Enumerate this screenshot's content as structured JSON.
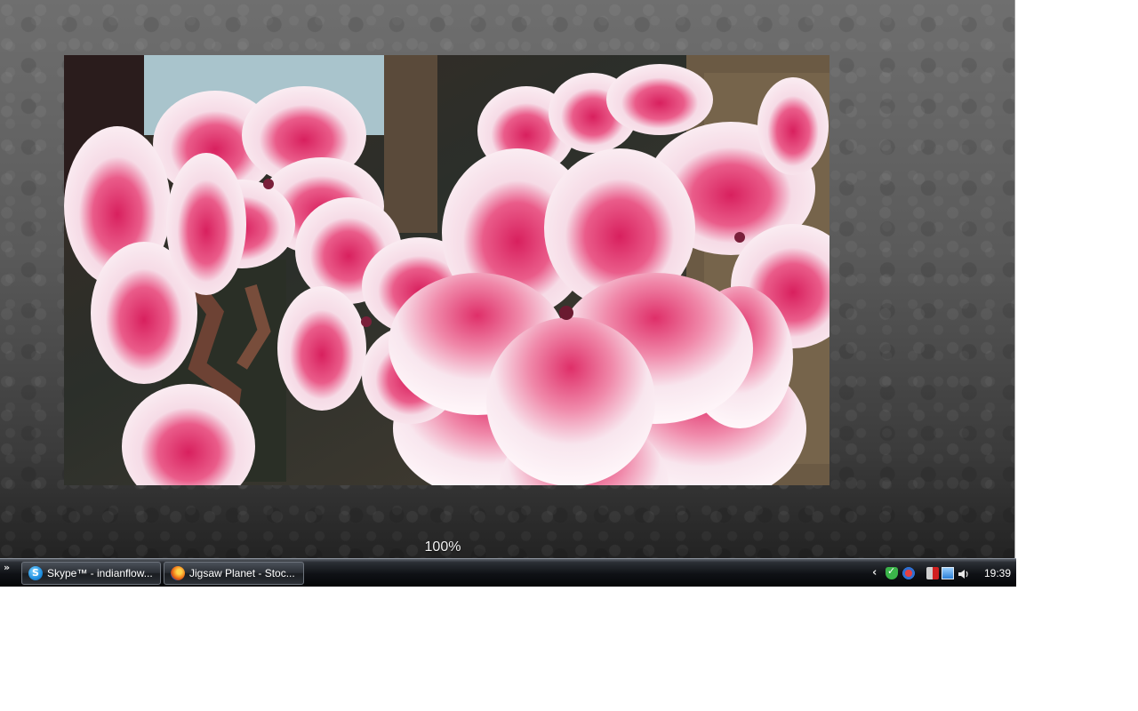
{
  "viewer": {
    "zoom_label": "100%"
  },
  "taskbar": {
    "quick_launch_label": "»",
    "tasks": [
      {
        "label": "Skype™ - indianflow...",
        "icon": "skype-icon"
      },
      {
        "label": "Jigsaw Planet - Stoc...",
        "icon": "firefox-icon"
      }
    ],
    "tray": {
      "expand_arrow": "‹",
      "icons": [
        "shield-check-icon",
        "security-icon",
        "power-icon",
        "network-icon",
        "volume-icon"
      ],
      "clock": "19:39"
    }
  },
  "colors": {
    "petal_pink": "#e8336e",
    "petal_white": "#f7eef2",
    "taskbar_dark": "#0f1115",
    "desktop_gray": "#5a5a5a"
  }
}
